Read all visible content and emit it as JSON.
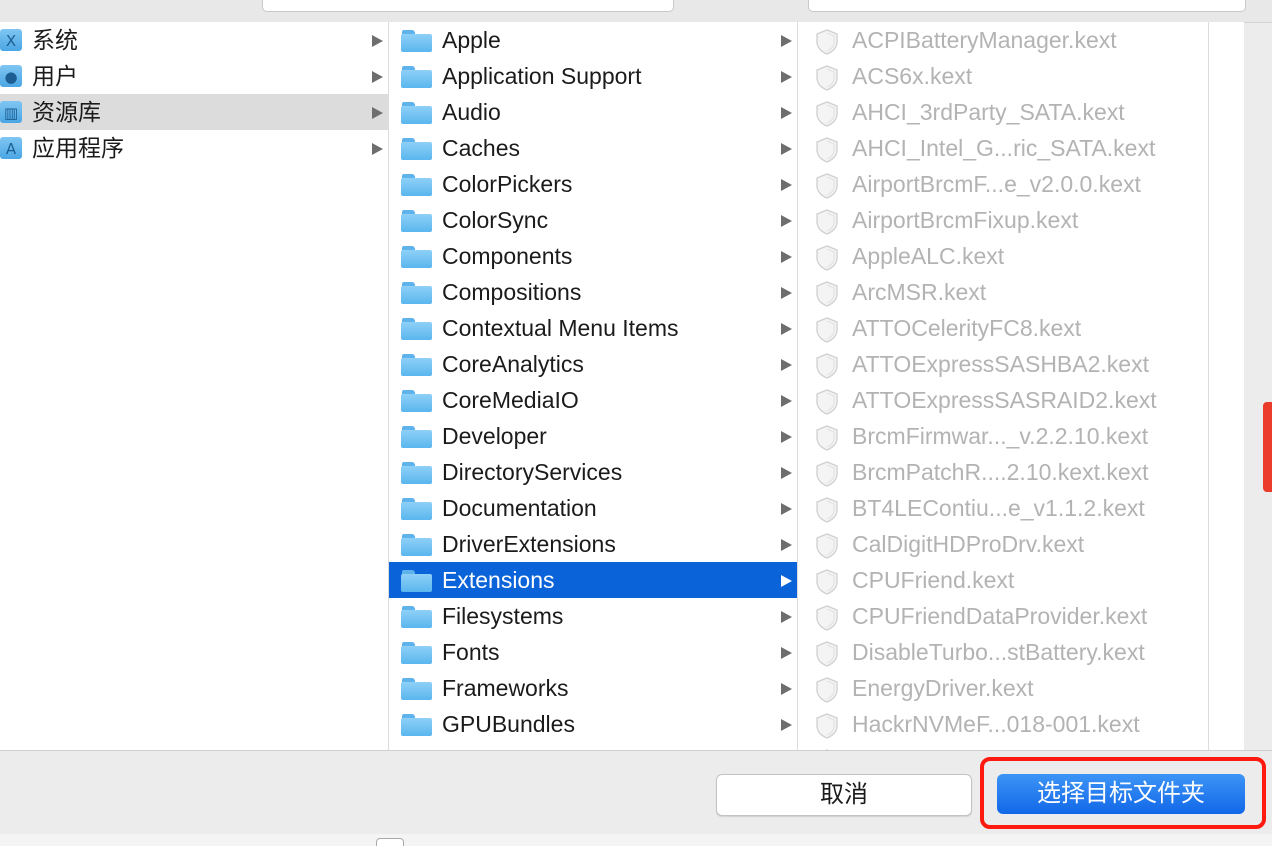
{
  "sidebar": {
    "items": [
      {
        "label": "系统",
        "icon": "system-folder-icon",
        "glyph": "X",
        "selected": false
      },
      {
        "label": "用户",
        "icon": "users-folder-icon",
        "glyph": "●",
        "selected": false
      },
      {
        "label": "资源库",
        "icon": "library-folder-icon",
        "glyph": "▥",
        "selected": true
      },
      {
        "label": "应用程序",
        "icon": "applications-folder-icon",
        "glyph": "A",
        "selected": false
      }
    ]
  },
  "library": {
    "items": [
      {
        "label": "Apple",
        "selected": false
      },
      {
        "label": "Application Support",
        "selected": false
      },
      {
        "label": "Audio",
        "selected": false
      },
      {
        "label": "Caches",
        "selected": false
      },
      {
        "label": "ColorPickers",
        "selected": false
      },
      {
        "label": "ColorSync",
        "selected": false
      },
      {
        "label": "Components",
        "selected": false
      },
      {
        "label": "Compositions",
        "selected": false
      },
      {
        "label": "Contextual Menu Items",
        "selected": false
      },
      {
        "label": "CoreAnalytics",
        "selected": false
      },
      {
        "label": "CoreMediaIO",
        "selected": false
      },
      {
        "label": "Developer",
        "selected": false
      },
      {
        "label": "DirectoryServices",
        "selected": false
      },
      {
        "label": "Documentation",
        "selected": false
      },
      {
        "label": "DriverExtensions",
        "selected": false
      },
      {
        "label": "Extensions",
        "selected": true
      },
      {
        "label": "Filesystems",
        "selected": false
      },
      {
        "label": "Fonts",
        "selected": false
      },
      {
        "label": "Frameworks",
        "selected": false
      },
      {
        "label": "GPUBundles",
        "selected": false
      }
    ]
  },
  "extensions": {
    "items": [
      "ACPIBatteryManager.kext",
      "ACS6x.kext",
      "AHCI_3rdParty_SATA.kext",
      "AHCI_Intel_G...ric_SATA.kext",
      "AirportBrcmF...e_v2.0.0.kext",
      "AirportBrcmFixup.kext",
      "AppleALC.kext",
      "ArcMSR.kext",
      "ATTOCelerityFC8.kext",
      "ATTOExpressSASHBA2.kext",
      "ATTOExpressSASRAID2.kext",
      "BrcmFirmwar..._v.2.2.10.kext",
      "BrcmPatchR....2.10.kext.kext",
      "BT4LEContiu...e_v1.1.2.kext",
      "CalDigitHDProDrv.kext",
      "CPUFriend.kext",
      "CPUFriendDataProvider.kext",
      "DisableTurbo...stBattery.kext",
      "EnergyDriver.kext",
      "HackrNVMeF...018-001.kext"
    ]
  },
  "buttons": {
    "cancel_label": "取消",
    "choose_label": "选择目标文件夹"
  },
  "colors": {
    "selection_blue": "#0a63d8",
    "highlight_red": "#ff1a0f",
    "folder_blue": "#5ab6ee",
    "dimmed_text": "#b3b3b3"
  }
}
